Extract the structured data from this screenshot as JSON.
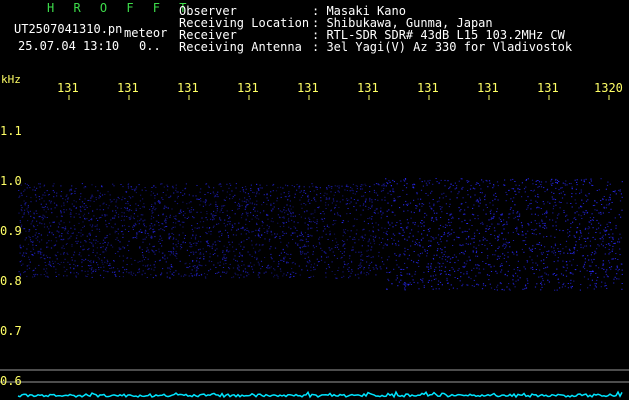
{
  "header": {
    "brand": "H R O F F T",
    "filename": "UT2507041310.pn",
    "mode": "meteor",
    "datetime": "25.07.04 13:10",
    "count": "0..",
    "fields": [
      {
        "label": "Observer",
        "value": ": Masaki Kano"
      },
      {
        "label": "Receiving Location",
        "value": ": Shibukawa, Gunma, Japan"
      },
      {
        "label": "Receiver",
        "value": ": RTL-SDR SDR# 43dB L15 103.2MHz CW"
      },
      {
        "label": "Receiving Antenna",
        "value": ": 3el Yagi(V) Az 330 for Vladivostok"
      }
    ]
  },
  "axis": {
    "unit": "kHz",
    "time_ticks": [
      "131",
      "131",
      "131",
      "131",
      "131",
      "131",
      "131",
      "131",
      "131",
      "1320"
    ],
    "freq_ticks": [
      "1.1",
      "1.0",
      "0.9",
      "0.8",
      "0.7",
      "0.6"
    ]
  },
  "colors": {
    "signal": "#2a2aff",
    "axis_label": "#ffff66",
    "noise_floor": "#00e5ff",
    "brand": "#3ddc4a"
  }
}
